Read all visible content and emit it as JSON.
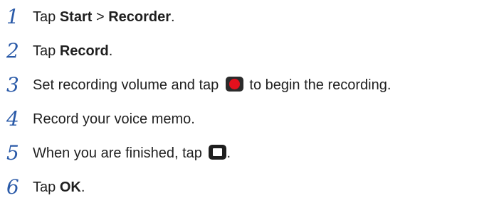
{
  "steps": [
    {
      "number": "1",
      "parts": [
        {
          "text": "Tap ",
          "bold": false
        },
        {
          "text": "Start",
          "bold": true
        },
        {
          "text": " > ",
          "bold": false
        },
        {
          "text": "Recorder",
          "bold": true
        },
        {
          "text": ".",
          "bold": false
        }
      ]
    },
    {
      "number": "2",
      "parts": [
        {
          "text": "Tap ",
          "bold": false
        },
        {
          "text": "Record",
          "bold": true
        },
        {
          "text": ".",
          "bold": false
        }
      ]
    },
    {
      "number": "3",
      "parts": [
        {
          "text": "Set recording volume and tap ",
          "bold": false
        },
        {
          "icon": "record-icon"
        },
        {
          "text": " to begin the recording.",
          "bold": false
        }
      ]
    },
    {
      "number": "4",
      "parts": [
        {
          "text": "Record your voice memo.",
          "bold": false
        }
      ]
    },
    {
      "number": "5",
      "parts": [
        {
          "text": "When you are finished, tap ",
          "bold": false
        },
        {
          "icon": "stop-icon"
        },
        {
          "text": ".",
          "bold": false
        }
      ]
    },
    {
      "number": "6",
      "parts": [
        {
          "text": "Tap ",
          "bold": false
        },
        {
          "text": "OK",
          "bold": true
        },
        {
          "text": ".",
          "bold": false
        }
      ]
    }
  ]
}
